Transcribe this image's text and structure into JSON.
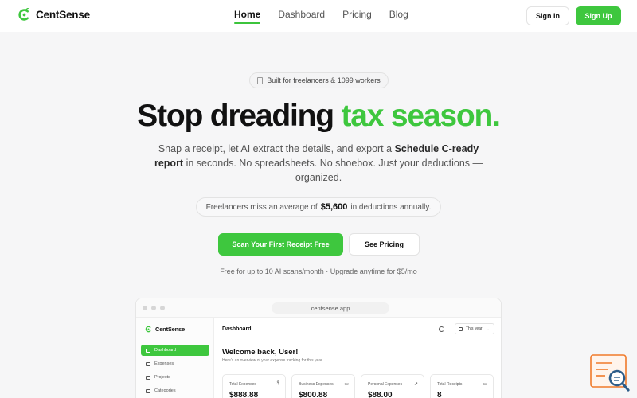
{
  "nav": {
    "brand": "CentSense",
    "links": [
      {
        "label": "Home",
        "active": true
      },
      {
        "label": "Dashboard",
        "active": false
      },
      {
        "label": "Pricing",
        "active": false
      },
      {
        "label": "Blog",
        "active": false
      }
    ],
    "sign_in": "Sign In",
    "sign_up": "Sign Up"
  },
  "hero": {
    "badge": "Built for freelancers & 1099 workers",
    "headline_main": "Stop dreading ",
    "headline_accent": "tax season.",
    "sub_pre": "Snap a receipt, let AI extract the details, and export a ",
    "sub_bold": "Schedule C-ready report",
    "sub_post": " in seconds. No spreadsheets. No shoebox. Just your deductions — organized.",
    "stat_pre": "Freelancers miss an average of",
    "stat_value": "$5,600",
    "stat_post": "in deductions annually.",
    "primary_cta": "Scan Your First Receipt Free",
    "secondary_cta": "See Pricing",
    "fine_print": "Free for up to 10 AI scans/month · Upgrade anytime for $5/mo"
  },
  "mockup": {
    "url": "centsense.app",
    "brand": "CentSense",
    "sidebar": [
      {
        "label": "Dashboard",
        "active": true
      },
      {
        "label": "Expenses",
        "active": false
      },
      {
        "label": "Projects",
        "active": false
      },
      {
        "label": "Categories",
        "active": false
      }
    ],
    "page_title": "Dashboard",
    "year_select": "This year",
    "welcome": "Welcome back, User!",
    "welcome_sub": "Here's an overview of your expense tracking for this year.",
    "cards": [
      {
        "label": "Total Expenses",
        "icon": "$",
        "value": "$888.88"
      },
      {
        "label": "Business Expenses",
        "icon": "▭",
        "value": "$800.88"
      },
      {
        "label": "Personal Expenses",
        "icon": "↗",
        "value": "$88.00"
      },
      {
        "label": "Total Receipts",
        "icon": "▭",
        "value": "8"
      }
    ]
  },
  "colors": {
    "accent": "#3ec73e",
    "text": "#111111",
    "muted": "#555555",
    "background": "#f6f6f7"
  }
}
